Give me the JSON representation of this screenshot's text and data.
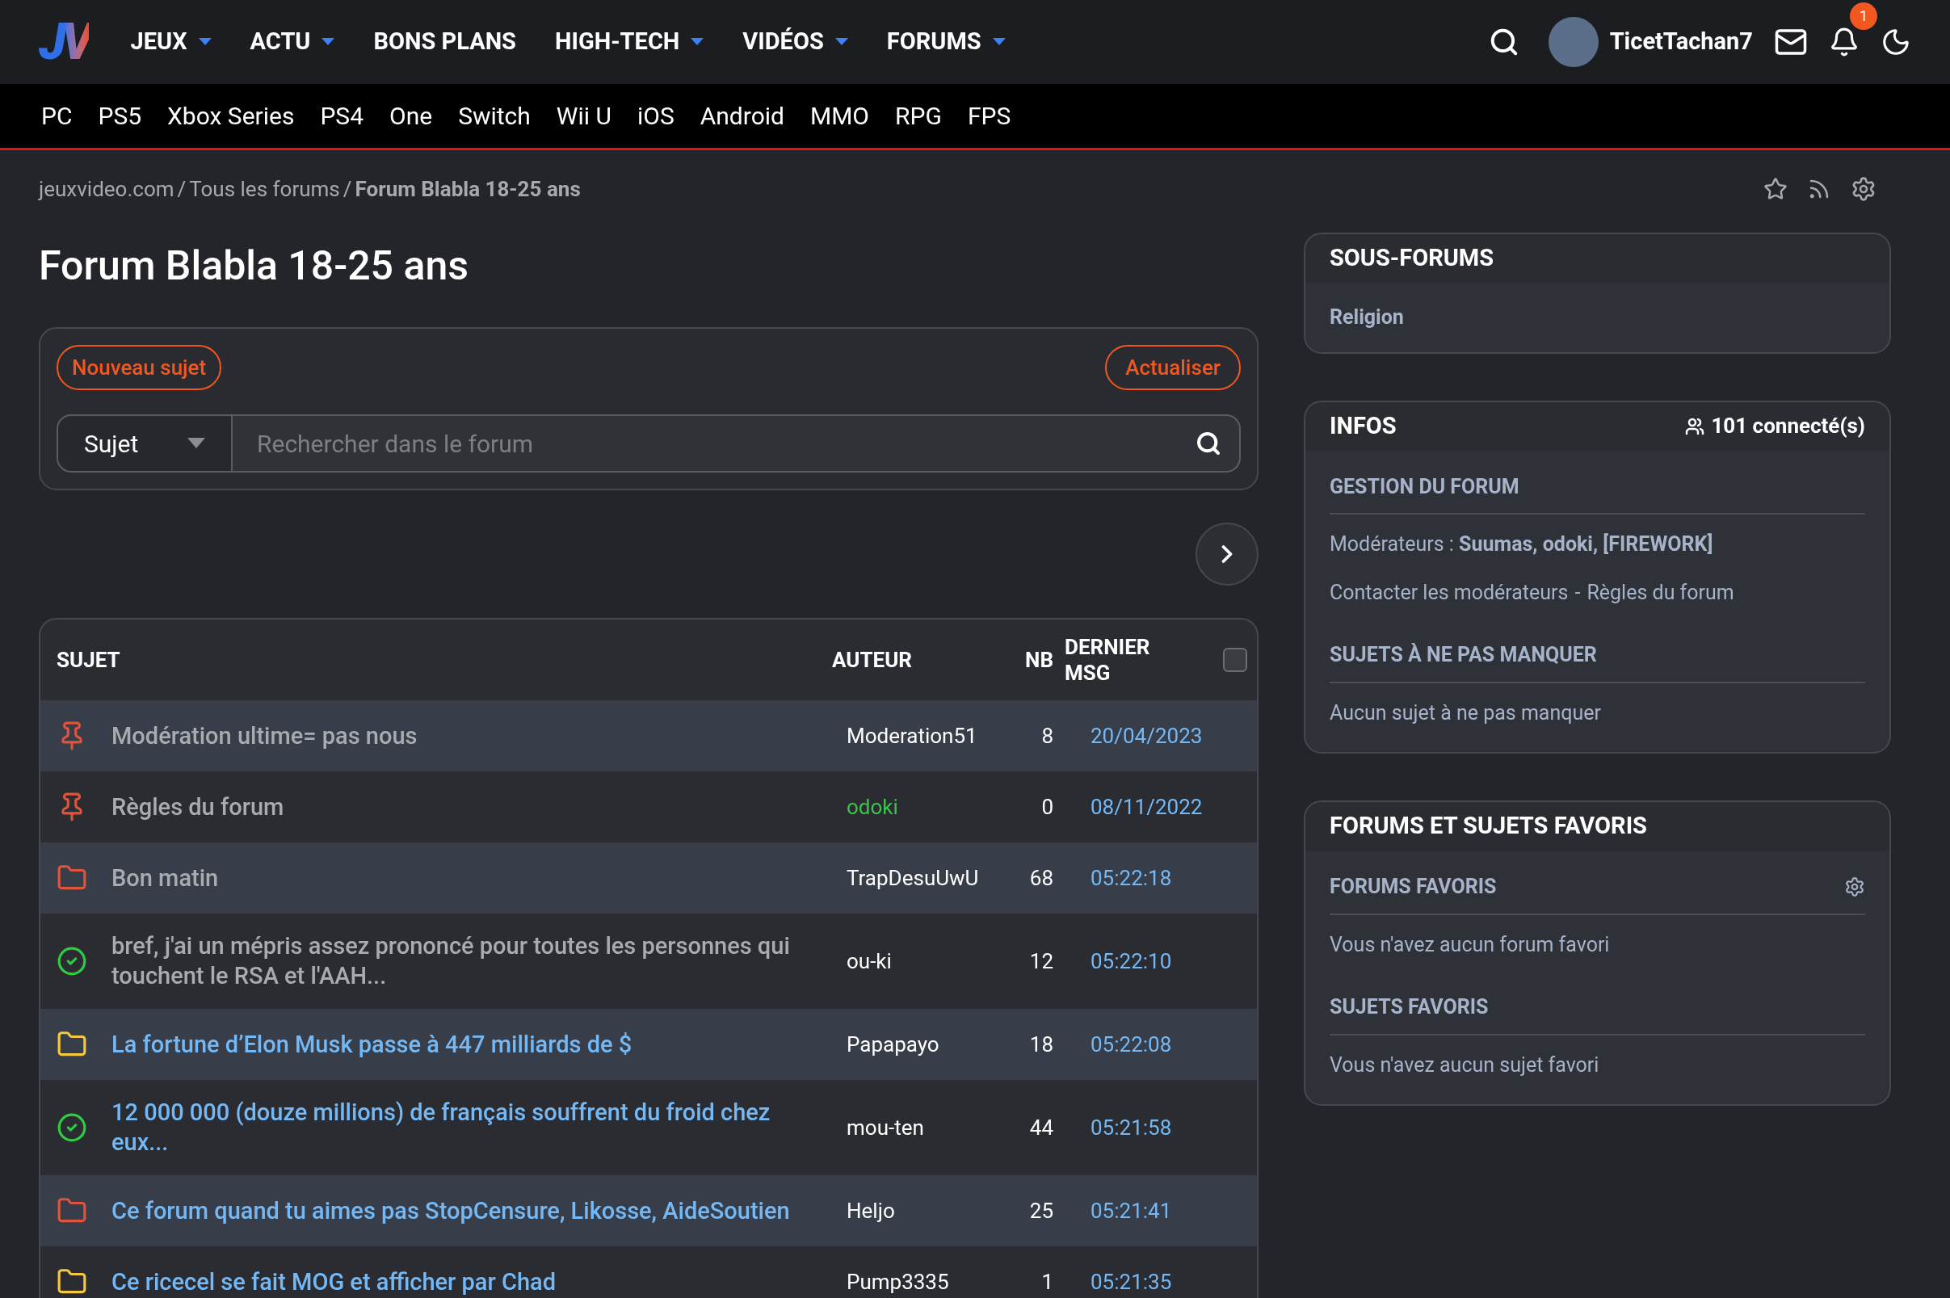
{
  "header": {
    "logo": "JV",
    "nav": [
      {
        "label": "JEUX",
        "dropdown": true
      },
      {
        "label": "ACTU",
        "dropdown": true
      },
      {
        "label": "BONS PLANS",
        "dropdown": false
      },
      {
        "label": "HIGH-TECH",
        "dropdown": true
      },
      {
        "label": "VIDÉOS",
        "dropdown": true
      },
      {
        "label": "FORUMS",
        "dropdown": true
      }
    ],
    "username": "TicetTachan7",
    "notification_count": "1"
  },
  "platforms": [
    "PC",
    "PS5",
    "Xbox Series",
    "PS4",
    "One",
    "Switch",
    "Wii U",
    "iOS",
    "Android",
    "MMO",
    "RPG",
    "FPS"
  ],
  "breadcrumb": [
    "jeuxvideo.com",
    "Tous les forums",
    "Forum Blabla 18-25 ans"
  ],
  "breadcrumb_separator": "/",
  "title": "Forum Blabla 18-25 ans",
  "toolbar": {
    "new_topic": "Nouveau sujet",
    "refresh": "Actualiser",
    "search_scope": "Sujet",
    "search_placeholder": "Rechercher dans le forum"
  },
  "table": {
    "columns": [
      "SUJET",
      "AUTEUR",
      "NB",
      "DERNIER MSG"
    ],
    "select_all_checked": false,
    "rows": [
      {
        "kind": "pin",
        "color": "#e0533d",
        "title": "Modération ultime= pas nous",
        "visited": true,
        "author": "Moderation51",
        "moderator": false,
        "count": "8",
        "last": "20/04/2023"
      },
      {
        "kind": "pin",
        "color": "#e0533d",
        "title": "Règles du forum",
        "visited": true,
        "author": "odoki",
        "moderator": true,
        "count": "0",
        "last": "08/11/2022"
      },
      {
        "kind": "folder",
        "color": "#e0533d",
        "title": "Bon matin",
        "visited": true,
        "author": "TrapDesuUwU",
        "moderator": false,
        "count": "68",
        "last": "05:22:18"
      },
      {
        "kind": "check",
        "color": "#2ecc40",
        "title": "bref, j'ai un mépris assez prononcé pour toutes les personnes qui touchent le RSA et l'AAH...",
        "visited": true,
        "author": "ou-ki",
        "moderator": false,
        "count": "12",
        "last": "05:22:10"
      },
      {
        "kind": "folder",
        "color": "#f5c842",
        "title": "La fortune d’Elon Musk passe à 447 milliards de $",
        "visited": false,
        "author": "Papapayo",
        "moderator": false,
        "count": "18",
        "last": "05:22:08"
      },
      {
        "kind": "check",
        "color": "#2ecc40",
        "title": "12 000 000 (douze millions) de français souffrent du froid chez eux...",
        "visited": false,
        "author": "mou-ten",
        "moderator": false,
        "count": "44",
        "last": "05:21:58"
      },
      {
        "kind": "folder",
        "color": "#e0533d",
        "title": "Ce forum quand tu aimes pas StopCensure, Likosse, AideSoutien",
        "visited": false,
        "author": "Heljo",
        "moderator": false,
        "count": "25",
        "last": "05:21:41"
      },
      {
        "kind": "folder",
        "color": "#f5c842",
        "title": "Ce ricecel se fait MOG et afficher par Chad",
        "visited": false,
        "author": "Pump3335",
        "moderator": false,
        "count": "1",
        "last": "05:21:35"
      }
    ]
  },
  "sidebar": {
    "subforums": {
      "title": "SOUS-FORUMS",
      "items": [
        "Religion"
      ]
    },
    "infos": {
      "title": "INFOS",
      "connected": "101 connecté(s)",
      "management_title": "GESTION DU FORUM",
      "moderators_label": "Modérateurs :",
      "moderators": "Suumas, odoki, [FIREWORK]",
      "contact": "Contacter les modérateurs",
      "separator": "-",
      "rules": "Règles du forum",
      "must_read_title": "SUJETS À NE PAS MANQUER",
      "must_read_empty": "Aucun sujet à ne pas manquer"
    },
    "favorites": {
      "title": "FORUMS ET SUJETS FAVORIS",
      "forums_title": "FORUMS FAVORIS",
      "forums_empty": "Vous n'avez aucun forum favori",
      "topics_title": "SUJETS FAVORIS",
      "topics_empty": "Vous n'avez aucun sujet favori"
    }
  }
}
